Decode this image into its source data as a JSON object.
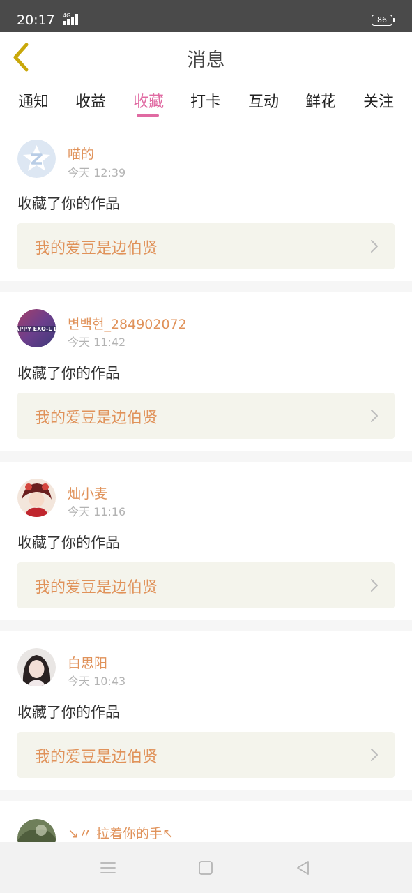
{
  "status_bar": {
    "time": "20:17",
    "network": "4G",
    "battery": "86"
  },
  "header": {
    "title": "消息",
    "back_icon": "chevron-left-icon"
  },
  "tabs": [
    {
      "label": "通知",
      "active": false
    },
    {
      "label": "收益",
      "active": false
    },
    {
      "label": "收藏",
      "active": true
    },
    {
      "label": "打卡",
      "active": false
    },
    {
      "label": "互动",
      "active": false
    },
    {
      "label": "鲜花",
      "active": false
    },
    {
      "label": "关注",
      "active": false
    }
  ],
  "messages": [
    {
      "name": "喵的",
      "time": "今天 12:39",
      "action": "收藏了你的作品",
      "work": "我的爱豆是边伯贤"
    },
    {
      "name": "변백현_284902072",
      "time": "今天 11:42",
      "action": "收藏了你的作品",
      "work": "我的爱豆是边伯贤"
    },
    {
      "name": "灿小麦",
      "time": "今天 11:16",
      "action": "收藏了你的作品",
      "work": "我的爱豆是边伯贤"
    },
    {
      "name": "白思阳",
      "time": "今天 10:43",
      "action": "收藏了你的作品",
      "work": "我的爱豆是边伯贤"
    },
    {
      "name": "↘〃 拉着你的手↖",
      "time": "",
      "action": "",
      "work": ""
    }
  ],
  "avatar_text": {
    "card2": "APPY EXO-L D"
  },
  "colors": {
    "accent_pink": "#e06aa2",
    "username_orange": "#e0925a",
    "work_box_bg": "#f4f4ec",
    "status_bar_bg": "#4a4a4a"
  },
  "nav": {
    "menu_icon": "menu-icon",
    "home_icon": "square-icon",
    "back_icon": "triangle-back-icon"
  }
}
